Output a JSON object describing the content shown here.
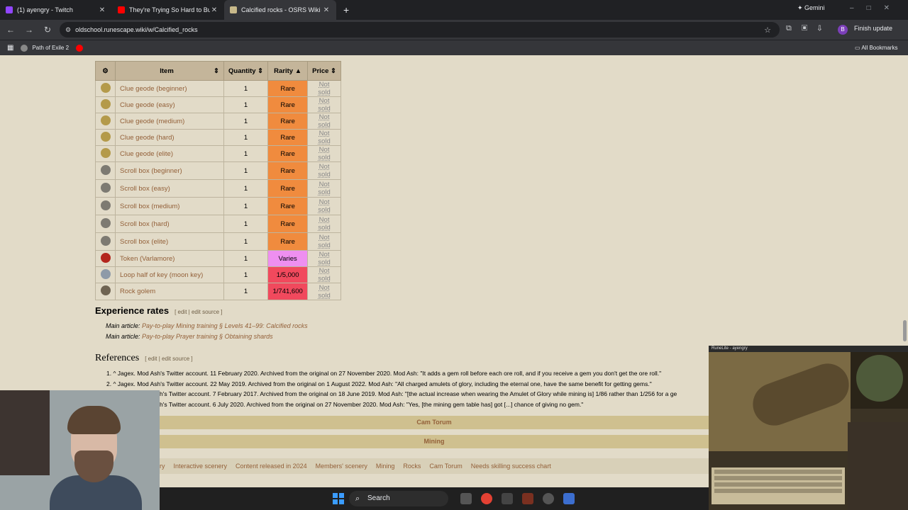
{
  "browser": {
    "tabs": [
      {
        "title": "(1) ayengry - Twitch",
        "active": false
      },
      {
        "title": "They're Trying So Hard to Bury",
        "active": false
      },
      {
        "title": "Calcified rocks - OSRS Wiki",
        "active": true
      }
    ],
    "new_tab": "+",
    "gemini_label": "Gemini",
    "url": "oldschool.runescape.wiki/w/Calcified_rocks",
    "finish_update": "Finish update",
    "avatar_letter": "B",
    "bookmarks": [
      "Path of Exile 2"
    ],
    "all_bookmarks": "All Bookmarks"
  },
  "table": {
    "headers": [
      "Item",
      "Quantity",
      "Rarity",
      "Price"
    ],
    "rows": [
      {
        "item": "Clue geode (beginner)",
        "qty": "1",
        "rarity": "Rare",
        "price": "Not sold",
        "rarity_class": "rare",
        "icon": "geode-icon"
      },
      {
        "item": "Clue geode (easy)",
        "qty": "1",
        "rarity": "Rare",
        "price": "Not sold",
        "rarity_class": "rare",
        "icon": "geode-icon"
      },
      {
        "item": "Clue geode (medium)",
        "qty": "1",
        "rarity": "Rare",
        "price": "Not sold",
        "rarity_class": "rare",
        "icon": "geode-icon"
      },
      {
        "item": "Clue geode (hard)",
        "qty": "1",
        "rarity": "Rare",
        "price": "Not sold",
        "rarity_class": "rare",
        "icon": "geode-icon"
      },
      {
        "item": "Clue geode (elite)",
        "qty": "1",
        "rarity": "Rare",
        "price": "Not sold",
        "rarity_class": "rare",
        "icon": "geode-icon"
      },
      {
        "item": "Scroll box (beginner)",
        "qty": "1",
        "rarity": "Rare",
        "price": "Not sold",
        "rarity_class": "rare",
        "icon": "scroll-box-icon"
      },
      {
        "item": "Scroll box (easy)",
        "qty": "1",
        "rarity": "Rare",
        "price": "Not sold",
        "rarity_class": "rare",
        "icon": "scroll-box-icon"
      },
      {
        "item": "Scroll box (medium)",
        "qty": "1",
        "rarity": "Rare",
        "price": "Not sold",
        "rarity_class": "rare",
        "icon": "scroll-box-icon"
      },
      {
        "item": "Scroll box (hard)",
        "qty": "1",
        "rarity": "Rare",
        "price": "Not sold",
        "rarity_class": "rare",
        "icon": "scroll-box-icon"
      },
      {
        "item": "Scroll box (elite)",
        "qty": "1",
        "rarity": "Rare",
        "price": "Not sold",
        "rarity_class": "rare",
        "icon": "scroll-box-icon"
      },
      {
        "item": "Token (Varlamore)",
        "qty": "1",
        "rarity": "Varies",
        "price": "Not sold",
        "rarity_class": "varies",
        "icon": "token-icon"
      },
      {
        "item": "Loop half of key (moon key)",
        "qty": "1",
        "rarity": "1/5,000",
        "price": "Not sold",
        "rarity_class": "veryrare",
        "icon": "key-half-icon"
      },
      {
        "item": "Rock golem",
        "qty": "1",
        "rarity": "1/741,600",
        "price": "Not sold",
        "rarity_class": "veryrare",
        "icon": "rock-golem-icon"
      }
    ]
  },
  "experience": {
    "heading": "Experience rates",
    "edit": "[ edit | edit source ]",
    "main_articles": [
      {
        "prefix": "Main article: ",
        "link": "Pay-to-play Mining training § Levels 41–99: Calcified rocks"
      },
      {
        "prefix": "Main article: ",
        "link": "Pay-to-play Prayer training § Obtaining shards"
      }
    ]
  },
  "references": {
    "heading": "References",
    "edit": "[ edit | edit source ]",
    "items": [
      "1. ^ Jagex. Mod Ash's Twitter account. 11 February 2020. Archived from the original on 27 November 2020. Mod Ash: \"It adds a gem roll before each ore roll, and if you receive a gem you don't get the ore roll.\"",
      "2. ^ Jagex. Mod Ash's Twitter account. 22 May 2019. Archived from the original on 1 August 2022. Mod Ash: \"All charged amulets of glory, including the eternal one, have the same benefit for getting gems.\"",
      "h's Twitter account. 7 February 2017. Archived from the original on 18 June 2019. Mod Ash: \"[the actual increase when wearing the Amulet of Glory while mining is] 1/86 rather than 1/256 for a ge",
      "h's Twitter account. 6 July 2020. Archived from the original on 27 November 2020. Mod Ash: \"Yes, [the mining gem table has] got [...] chance of giving no gem.\""
    ]
  },
  "navboxes": [
    "Cam Torum",
    "Mining"
  ],
  "categories": [
    "ry",
    "Interactive scenery",
    "Content released in 2024",
    "Members' scenery",
    "Mining",
    "Rocks",
    "Cam Torum",
    "Needs skilling success chart"
  ],
  "taskbar": {
    "search": "Search"
  },
  "game": {
    "title": "RuneLite - ayengry"
  }
}
